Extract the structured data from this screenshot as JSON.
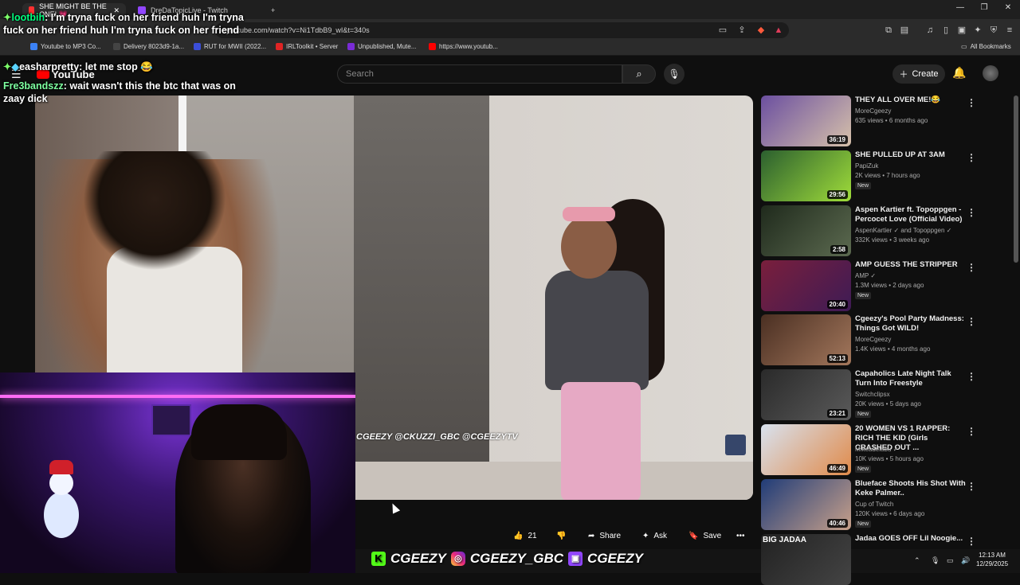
{
  "browser": {
    "tabs": [
      {
        "label": "SHE MIGHT BE THE ONE! 💗",
        "active": true,
        "color": "#ff3030"
      },
      {
        "label": "DreDaTopicLive - Twitch",
        "active": false,
        "color": "#9146ff"
      }
    ],
    "new_tab": "+",
    "url": "youtube.com/watch?v=Ni1TdbB9_wI&t=340s",
    "bookmarks": [
      {
        "label": "Youtube to MP3 Co...",
        "color": "#3b82f6"
      },
      {
        "label": "Delivery 8023d9-1a...",
        "color": "#444444"
      },
      {
        "label": "RUT for MWII (2022...",
        "color": "#3b4ed8"
      },
      {
        "label": "IRLToolkit • Server",
        "color": "#e02424"
      },
      {
        "label": "Unpublished, Mute...",
        "color": "#7a2bd6"
      },
      {
        "label": "https://www.youtub...",
        "color": "#ff0000"
      }
    ],
    "all_bookmarks": "All Bookmarks"
  },
  "youtube": {
    "logo": "YouTube",
    "search_placeholder": "Search",
    "create_label": "Create",
    "actions": {
      "likes": "21",
      "share": "Share",
      "ask": "Ask",
      "save": "Save"
    },
    "watermark": "CGEEZY @CKUZZI_GBC @CGEEZYTV"
  },
  "chat": [
    {
      "user": "lootbih",
      "text": "I'm tryna fuck on her friend huh I'm tryna fuck on her friend huh I'm tryna fuck on her friend"
    },
    {
      "user": "easharpretty",
      "text": "let me stop 😂"
    },
    {
      "user": "Fre3bandszz",
      "text": "wait wasn't this the btc that was on zaay dick"
    }
  ],
  "recommendations": [
    {
      "title": "THEY ALL OVER ME!😂",
      "channel": "MoreCgeezy",
      "meta": "635 views • 6 months ago",
      "duration": "36:19",
      "new": "",
      "c1": "#6b4fa0",
      "c2": "#d6c1aa"
    },
    {
      "title": "SHE PULLED UP AT 3AM",
      "channel": "PapiZuk",
      "meta": "2K views • 7 hours ago",
      "duration": "29:56",
      "new": "New",
      "c1": "#2b5f2f",
      "c2": "#9fdc3a"
    },
    {
      "title": "Aspen Kartier ft. Topoppgen - Percocet Love (Official Video)",
      "channel": "AspenKartier ✓ and Topoppgen ✓",
      "meta": "332K views • 3 weeks ago",
      "duration": "2:58",
      "new": "",
      "c1": "#1f2a1c",
      "c2": "#5c6a50"
    },
    {
      "title": "AMP GUESS THE STRIPPER",
      "channel": "AMP ✓",
      "meta": "1.3M views • 2 days ago",
      "duration": "20:40",
      "new": "New",
      "c1": "#7a1f3c",
      "c2": "#3e1b55"
    },
    {
      "title": "Cgeezy's Pool Party Madness: Things Got WILD!",
      "channel": "MoreCgeezy",
      "meta": "1.4K views • 4 months ago",
      "duration": "52:13",
      "new": "",
      "c1": "#4a2f22",
      "c2": "#a3775c"
    },
    {
      "title": "Capaholics Late Night Talk Turn Into Freestyle",
      "channel": "Switchclipsx",
      "meta": "20K views • 5 days ago",
      "duration": "23:21",
      "new": "New",
      "c1": "#2a2a2a",
      "c2": "#5a5a5a"
    },
    {
      "title": "20 WOMEN VS 1 RAPPER: RICH THE KID (Girls CRASHED OUT ...",
      "channel": "Mikeadelabu ✓",
      "meta": "10K views • 5 hours ago",
      "duration": "46:49",
      "new": "New",
      "c1": "#d8e2ef",
      "c2": "#e08a4a"
    },
    {
      "title": "Blueface Shoots His Shot With Keke Palmer..",
      "channel": "Cup of Twitch",
      "meta": "120K views • 6 days ago",
      "duration": "40:46",
      "new": "New",
      "c1": "#203c78",
      "c2": "#c7a08a"
    },
    {
      "title": "Jadaa GOES OFF Lil Noogie...",
      "channel": "",
      "meta": "",
      "duration": "",
      "new": "",
      "c1": "#222222",
      "c2": "#444444"
    }
  ],
  "thumb_overlay_text": "BIG JADAA",
  "social_bar": {
    "kick": "CGEEZY",
    "instagram": "CGEEZY_GBC",
    "twitch": "CGEEZY"
  },
  "clock": {
    "time": "12:13 AM",
    "date": "12/29/2025"
  },
  "icons": {
    "menu": "hamburger-icon",
    "search": "search-icon",
    "mic": "mic-icon",
    "bell": "bell-icon"
  }
}
